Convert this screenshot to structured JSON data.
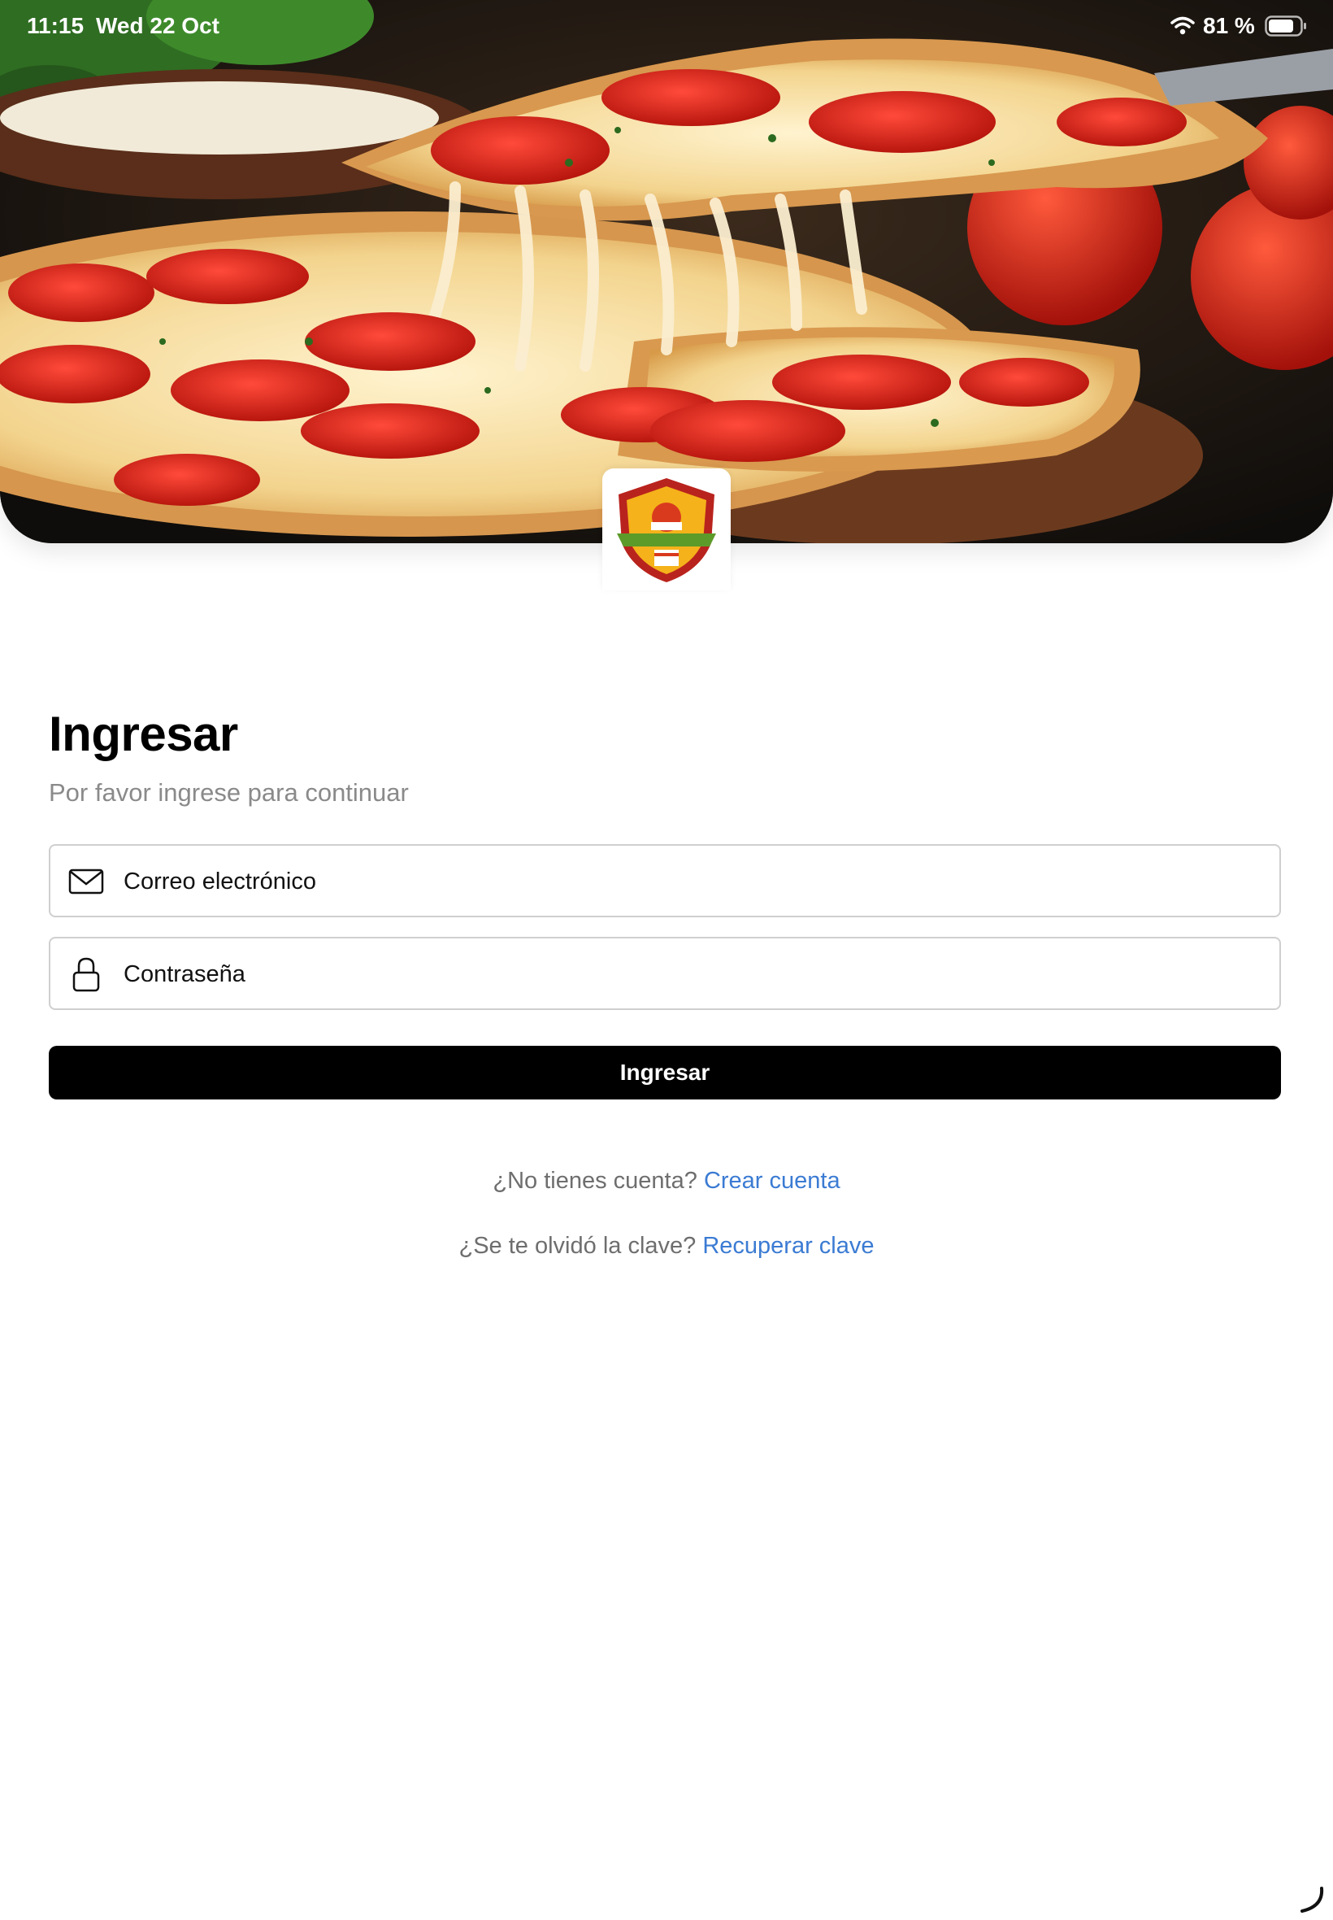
{
  "status_bar": {
    "time": "11:15",
    "date": "Wed 22 Oct",
    "battery_text": "81 %",
    "battery_level": 0.81,
    "icons": [
      "wifi-icon",
      "battery-icon"
    ]
  },
  "hero": {
    "image_subject": "pepperoni pizza with stretching cheese",
    "logo_icon": "pizza-shield-logo"
  },
  "form": {
    "title": "Ingresar",
    "subtitle": "Por favor ingrese para continuar",
    "email_placeholder": "Correo electrónico",
    "password_placeholder": "Contraseña",
    "submit_label": "Ingresar",
    "email_icon": "mail-icon",
    "password_icon": "lock-icon"
  },
  "links": {
    "signup_prompt": "¿No tienes cuenta?",
    "signup_link": "Crear cuenta",
    "recover_prompt": "¿Se te olvidó la clave?",
    "recover_link": "Recuperar clave"
  },
  "colors": {
    "primary_button": "#000000",
    "link": "#3b7bd3",
    "muted_text": "#8a8a8a",
    "field_border": "#cfcfcf"
  }
}
